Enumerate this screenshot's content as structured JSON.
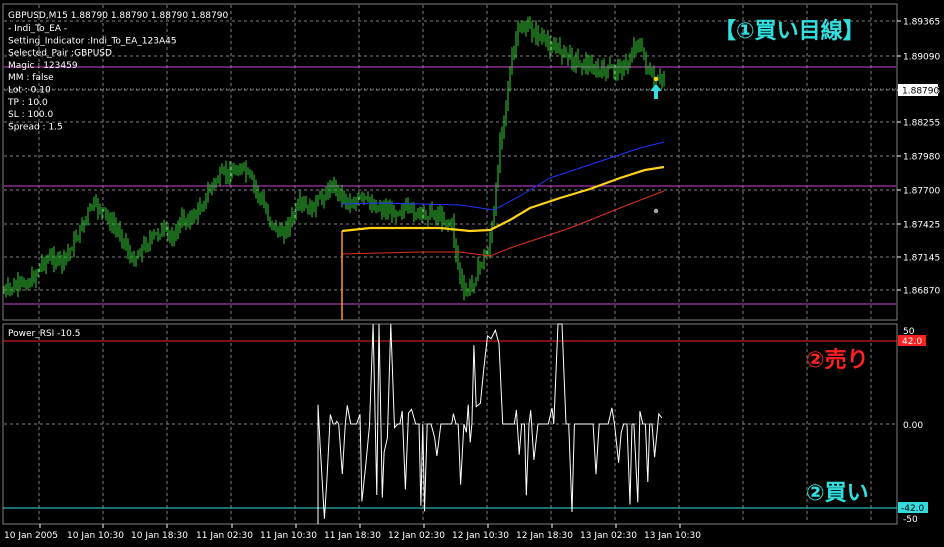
{
  "chart_window": {
    "symbol_header": "GBPUSD,M15  1.88790 1.88790 1.88790 1.88790",
    "ea_info": [
      "- Indi_To_EA -",
      "Setting_Indicator :Indi_To_EA_123A45",
      "Selected_Pair :GBPUSD",
      "Magic : 123459",
      "MM : false",
      "Lot : 0.10",
      "TP : 10.0",
      "SL : 100.0",
      "Spread : 1.5"
    ],
    "current_price_tag": "1.88790",
    "price_axis_labels": [
      "1.89365",
      "1.89090",
      "1.88535",
      "1.88255",
      "1.87980",
      "1.87700",
      "1.87425",
      "1.87145",
      "1.86870"
    ],
    "buy_view_annotation": "【①買い目線】"
  },
  "indicator_window": {
    "title": "Power_RSI -10.5",
    "axis_labels": [
      "50",
      "0.00",
      "-50"
    ],
    "upper_level_tag": "42.0",
    "lower_level_tag": "-42.0",
    "sell_annotation": "②売り",
    "buy_annotation": "②買い"
  },
  "time_axis_labels": [
    "10 Jan 2005",
    "10 Jan 10:30",
    "10 Jan 18:30",
    "11 Jan 02:30",
    "11 Jan 10:30",
    "11 Jan 18:30",
    "12 Jan 02:30",
    "12 Jan 10:30",
    "12 Jan 18:30",
    "13 Jan 02:30",
    "13 Jan 10:30"
  ],
  "colors": {
    "background": "#000000",
    "grid": "#7f7f7f",
    "candles": "#33cc33",
    "level_lines": "#cc44cc",
    "ma_yellow": "#ffd21a",
    "ma_blue": "#2233ff",
    "ma_red": "#e03020",
    "rsi_line": "#ffffff",
    "rsi_upper": "#ff2020",
    "rsi_lower": "#33dddd",
    "annotation_buy": "#33e0e0",
    "annotation_sell": "#ff2020"
  },
  "icons": {
    "buy_signal": "up-arrow-icon"
  }
}
